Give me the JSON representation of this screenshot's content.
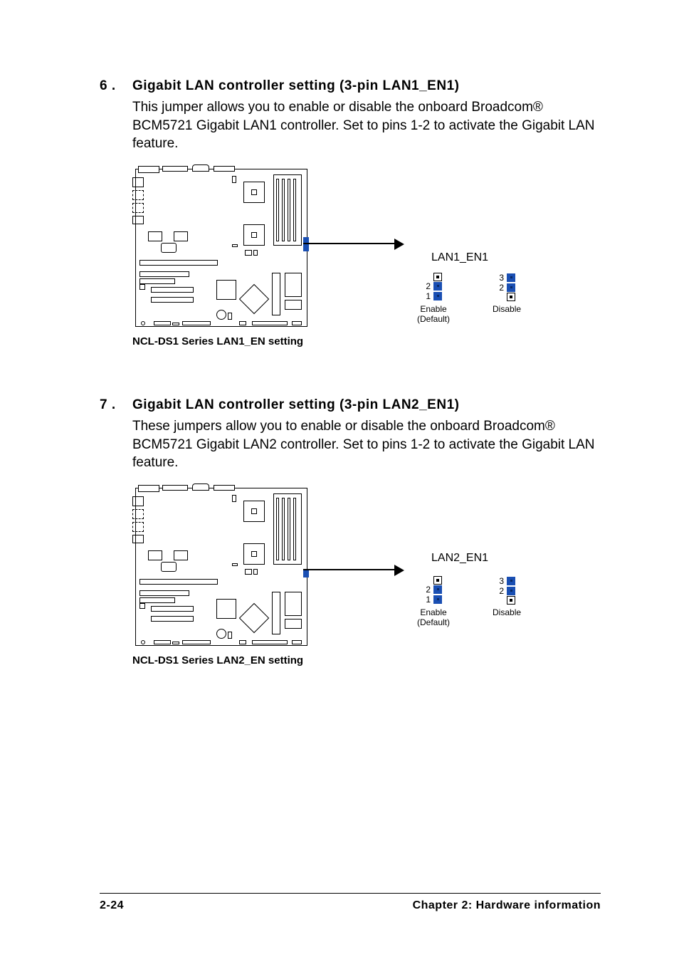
{
  "sections": [
    {
      "number": "6 .",
      "title": "Gigabit LAN controller setting (3-pin LAN1_EN1)",
      "body": "This jumper allows you to enable or disable the onboard Broadcom® BCM5721 Gigabit LAN1 controller. Set to pins 1-2 to activate the Gigabit LAN feature.",
      "jumper_label": "LAN1_EN1",
      "caption": "NCL-DS1 Series LAN1_EN setting",
      "enable": {
        "label": "Enable",
        "sublabel": "(Default)",
        "pin_top_num": "",
        "pin_mid_num": "2",
        "pin_bot_num": "1"
      },
      "disable": {
        "label": "Disable",
        "pin_top_num": "3",
        "pin_mid_num": "2",
        "pin_bot_num": ""
      }
    },
    {
      "number": "7 .",
      "title": "Gigabit LAN controller setting (3-pin LAN2_EN1)",
      "body": "These jumpers allow you to enable or disable the onboard Broadcom® BCM5721 Gigabit LAN2 controller. Set to pins 1-2 to activate the Gigabit LAN feature.",
      "jumper_label": "LAN2_EN1",
      "caption": "NCL-DS1 Series LAN2_EN setting",
      "enable": {
        "label": "Enable",
        "sublabel": "(Default)",
        "pin_top_num": "",
        "pin_mid_num": "2",
        "pin_bot_num": "1"
      },
      "disable": {
        "label": "Disable",
        "pin_top_num": "3",
        "pin_mid_num": "2",
        "pin_bot_num": ""
      }
    }
  ],
  "footer": {
    "page": "2-24",
    "chapter": "Chapter 2: Hardware information"
  }
}
